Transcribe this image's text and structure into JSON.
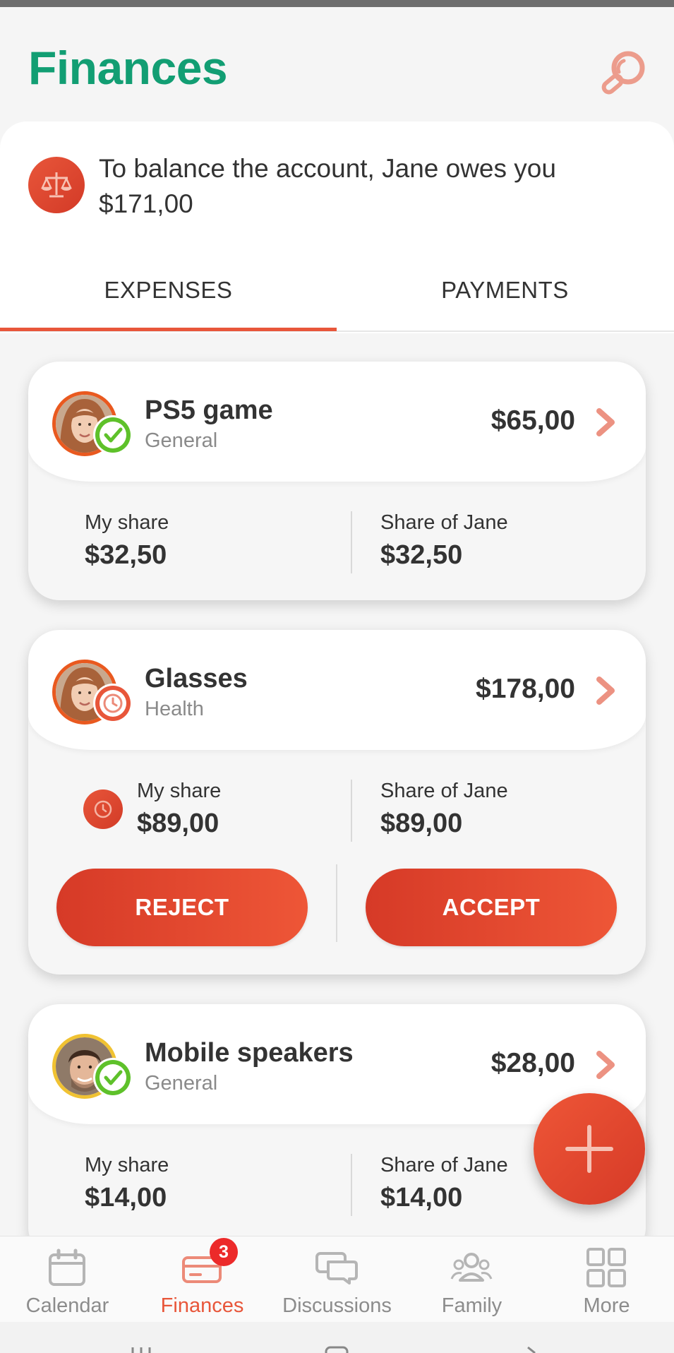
{
  "header": {
    "title": "Finances"
  },
  "balance": {
    "text": "To balance the account, Jane owes you $171,00"
  },
  "tabs": [
    {
      "label": "EXPENSES",
      "active": true
    },
    {
      "label": "PAYMENTS",
      "active": false
    }
  ],
  "expenses": [
    {
      "name": "PS5 game",
      "category": "General",
      "amount": "$65,00",
      "status": "accepted",
      "my_share_label": "My share",
      "my_share": "$32,50",
      "other_share_label": "Share of Jane",
      "other_share": "$32,50"
    },
    {
      "name": "Glasses",
      "category": "Health",
      "amount": "$178,00",
      "status": "pending",
      "my_share_label": "My share",
      "my_share": "$89,00",
      "other_share_label": "Share of Jane",
      "other_share": "$89,00",
      "reject_label": "REJECT",
      "accept_label": "ACCEPT"
    },
    {
      "name": "Mobile speakers",
      "category": "General",
      "amount": "$28,00",
      "status": "accepted",
      "my_share_label": "My share",
      "my_share": "$14,00",
      "other_share_label": "Share of Jane",
      "other_share": "$14,00"
    }
  ],
  "bottom_nav": [
    {
      "label": "Calendar",
      "icon": "calendar-icon"
    },
    {
      "label": "Finances",
      "icon": "wallet-icon",
      "active": true,
      "badge": "3"
    },
    {
      "label": "Discussions",
      "icon": "chat-icon"
    },
    {
      "label": "Family",
      "icon": "family-icon"
    },
    {
      "label": "More",
      "icon": "grid-icon"
    }
  ],
  "colors": {
    "title_green": "#129e73",
    "accent_orange": "#e8563a",
    "accepted_green": "#5ec12a",
    "badge_red": "#ec2a2a"
  }
}
